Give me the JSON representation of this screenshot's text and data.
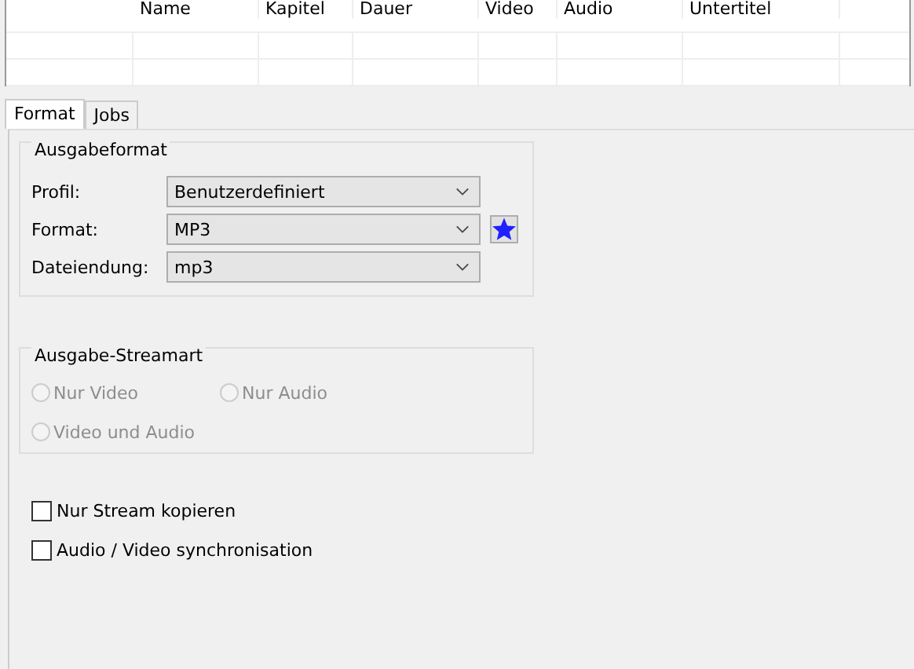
{
  "table": {
    "columns": [
      "Name",
      "Kapitel",
      "Dauer",
      "Video",
      "Audio",
      "Untertitel"
    ]
  },
  "tabs": [
    {
      "label": "Format",
      "selected": true
    },
    {
      "label": "Jobs",
      "selected": false
    }
  ],
  "output_format": {
    "title": "Ausgabeformat",
    "fields": [
      {
        "label": "Profil:",
        "value": "Benutzerdefiniert",
        "favorite": false
      },
      {
        "label": "Format:",
        "value": "MP3",
        "favorite": true
      },
      {
        "label": "Dateiendung:",
        "value": "mp3",
        "favorite": false
      }
    ]
  },
  "stream_type": {
    "title": "Ausgabe-Streamart",
    "disabled": true,
    "options": [
      {
        "label": "Nur Video",
        "selected": false
      },
      {
        "label": "Nur Audio",
        "selected": false
      },
      {
        "label": "Video und Audio",
        "selected": false
      }
    ]
  },
  "checkboxes": [
    {
      "label": "Nur Stream kopieren",
      "checked": false
    },
    {
      "label": "Audio / Video synchronisation",
      "checked": false
    }
  ]
}
